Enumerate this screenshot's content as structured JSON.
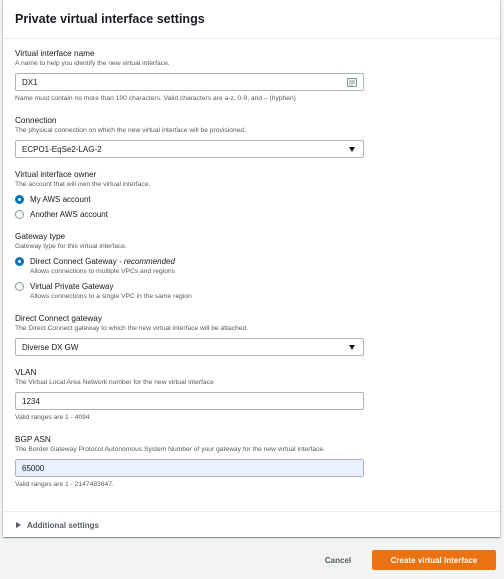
{
  "panel": {
    "title": "Private virtual interface settings"
  },
  "name_field": {
    "label": "Virtual interface name",
    "description": "A name to help you identify the new virtual interface.",
    "value": "DX1",
    "constraint": "Name must contain no more than 100 characters. Valid characters are a-z, 0-9, and – (hyphen)"
  },
  "connection_field": {
    "label": "Connection",
    "description": "The physical connection on which the new virtual interface will be provisioned.",
    "value": "ECPO1-EqSe2-LAG-2"
  },
  "owner_field": {
    "label": "Virtual interface owner",
    "description": "The account that will own the virtual interface.",
    "options": [
      {
        "label": "My AWS account",
        "checked": true
      },
      {
        "label": "Another AWS account",
        "checked": false
      }
    ]
  },
  "gateway_type_field": {
    "label": "Gateway type",
    "description": "Gateway type for this virtual interface.",
    "options": [
      {
        "label": "Direct Connect Gateway",
        "suffix": "- recommended",
        "desc": "Allows connections to multiple VPCs and regions",
        "checked": true
      },
      {
        "label": "Virtual Private Gateway",
        "suffix": "",
        "desc": "Allows connections to a single VPC in the same region",
        "checked": false
      }
    ]
  },
  "dx_gateway_field": {
    "label": "Direct Connect gateway",
    "description": "The Direct Connect gateway to which the new virtual interface will be attached.",
    "value": "Diverse DX GW"
  },
  "vlan_field": {
    "label": "VLAN",
    "description": "The Virtual Local Area Network number for the new virtual interface",
    "value": "1234",
    "constraint": "Valid ranges are 1 - 4094"
  },
  "asn_field": {
    "label": "BGP ASN",
    "description": "The Border Gateway Protocol Autonomous System Number of your gateway for the new virtual interface.",
    "value": "65000",
    "constraint": "Valid ranges are 1 - 2147483647."
  },
  "additional_settings": {
    "label": "Additional settings"
  },
  "footer": {
    "cancel_label": "Cancel",
    "create_label": "Create virtual interface"
  },
  "colors": {
    "accent": "#0073bb",
    "primary_button": "#ec7211"
  }
}
